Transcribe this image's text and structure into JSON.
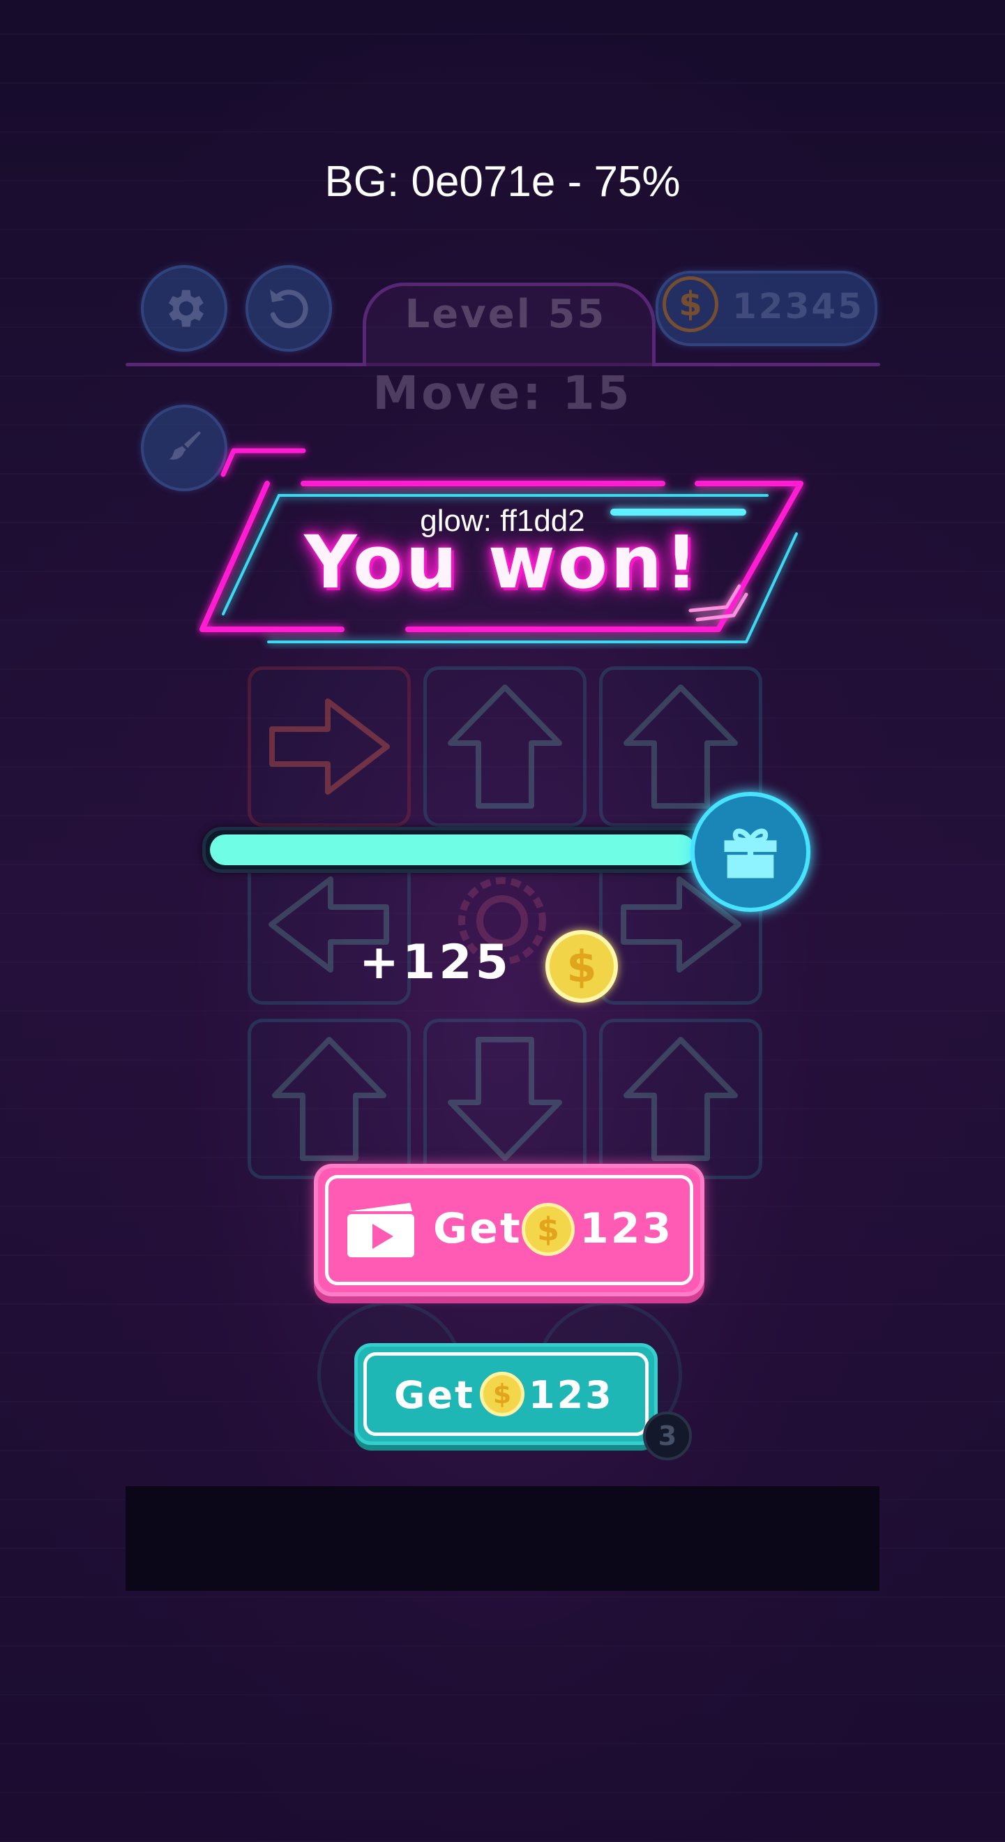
{
  "debug": {
    "bg_label": "BG: 0e071e  - 75%",
    "glow_label": "glow: ff1dd2"
  },
  "hud": {
    "level_label": "Level 55",
    "coins": "12345",
    "move_label": "Move:  15"
  },
  "icons": [
    "gear-icon",
    "restart-icon",
    "brush-icon",
    "coin-icon",
    "gift-icon",
    "video-icon",
    "arrow-icons"
  ],
  "grid": {
    "rows": [
      [
        "right",
        "up",
        "up"
      ],
      [
        "left",
        "blank",
        "right"
      ],
      [
        "up",
        "down",
        "up"
      ]
    ]
  },
  "banner": {
    "title": "You won!"
  },
  "reward": {
    "progress": 0.92,
    "amount": "+125"
  },
  "buttons": {
    "video_get_label": "Get",
    "video_get_amount": "123",
    "get_label": "Get",
    "get_amount": "123",
    "hint_badge": "3"
  },
  "colors": {
    "background": "#0e071e",
    "glow": "#ff1dd2",
    "accent_cyan": "#6ffde6",
    "pink_button": "#ff5ab4",
    "teal_button": "#1fb7b5"
  }
}
